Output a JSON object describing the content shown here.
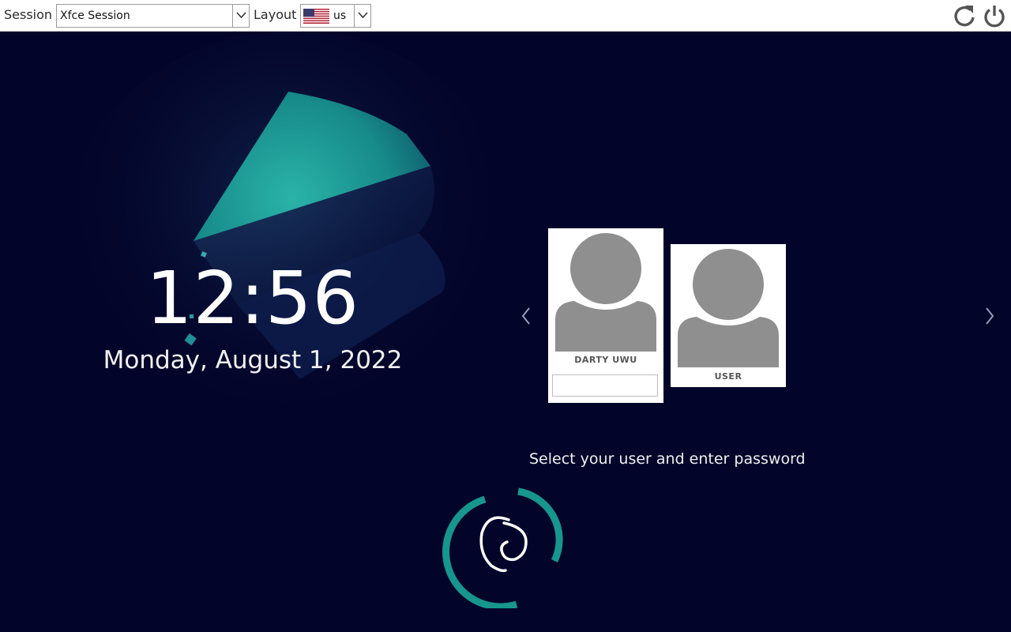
{
  "topbar": {
    "session_label": "Session",
    "session_value": "Xfce Session",
    "layout_label": "Layout",
    "layout_value": "us",
    "layout_flag_icon": "us-flag-icon",
    "restart_icon": "restart-icon",
    "shutdown_icon": "power-icon"
  },
  "clock": {
    "time": "12:56",
    "date": "Monday, August 1, 2022"
  },
  "users": [
    {
      "name": "DARTY UWU",
      "selected": true,
      "password_value": ""
    },
    {
      "name": "USER",
      "selected": false
    }
  ],
  "message": "Select your user and enter password",
  "colors": {
    "background": "#03042a",
    "accent_teal": "#1aa79a",
    "topbar": "#ffffff"
  }
}
